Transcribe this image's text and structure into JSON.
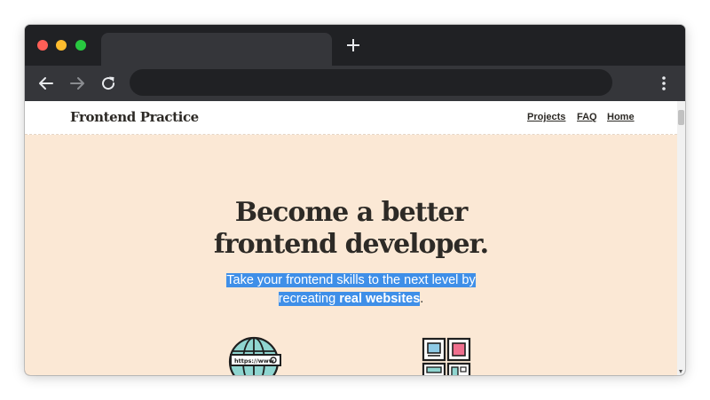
{
  "browser": {
    "tab_title": "",
    "address": ""
  },
  "site": {
    "logo": "Frontend Practice",
    "nav": [
      {
        "label": "Projects"
      },
      {
        "label": "FAQ"
      },
      {
        "label": "Home"
      }
    ]
  },
  "hero": {
    "title_line1": "Become a better",
    "title_line2": "frontend developer.",
    "sub_line1": "Take your frontend skills to the next level by",
    "sub_line2_before": "recreating ",
    "sub_line2_bold": "real websites",
    "sub_line2_after": "."
  },
  "illustrations": {
    "globe_url": "https://www"
  },
  "colors": {
    "hero_bg": "#fbe8d5",
    "text": "#2d2a26",
    "selection": "#3f8fe8",
    "globe_fill": "#8fd5d0",
    "tile_blue": "#8ecae6",
    "tile_pink": "#ef6f8e"
  }
}
